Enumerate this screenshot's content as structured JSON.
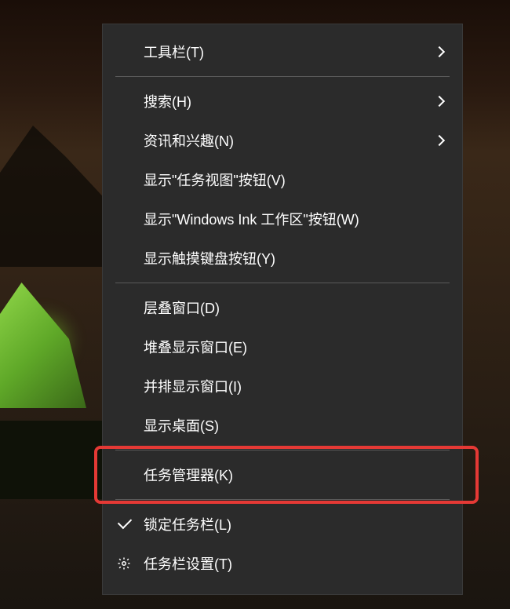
{
  "menu": {
    "items": [
      {
        "label": "工具栏(T)",
        "hasSubmenu": true
      },
      {
        "label": "搜索(H)",
        "hasSubmenu": true
      },
      {
        "label": "资讯和兴趣(N)",
        "hasSubmenu": true
      },
      {
        "label": "显示\"任务视图\"按钮(V)"
      },
      {
        "label": "显示\"Windows Ink 工作区\"按钮(W)"
      },
      {
        "label": "显示触摸键盘按钮(Y)"
      },
      {
        "label": "层叠窗口(D)"
      },
      {
        "label": "堆叠显示窗口(E)"
      },
      {
        "label": "并排显示窗口(I)"
      },
      {
        "label": "显示桌面(S)"
      },
      {
        "label": "任务管理器(K)"
      },
      {
        "label": "锁定任务栏(L)",
        "checked": true
      },
      {
        "label": "任务栏设置(T)",
        "icon": "gear"
      }
    ]
  },
  "highlighted_item_index": 10
}
